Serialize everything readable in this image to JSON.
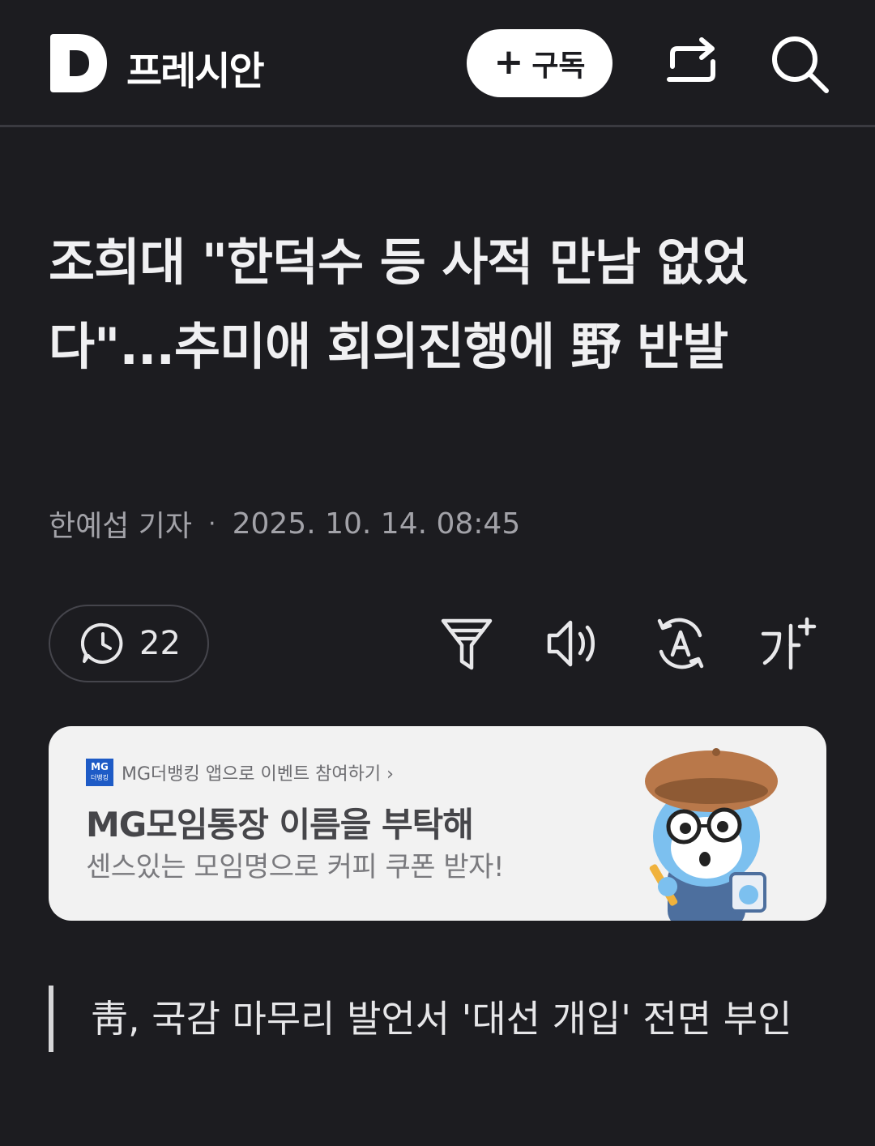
{
  "header": {
    "brand": "프레시안",
    "subscribe_label": "구독",
    "icons": [
      "daum-logo-icon",
      "plus-icon",
      "share-icon",
      "search-icon"
    ]
  },
  "article": {
    "headline": "조희대 \"한덕수 등 사적 만남 없었다\"...추미애 회의진행에 野 반발",
    "author": "한예섭 기자",
    "dot": "·",
    "datetime": "2025. 10. 14. 08:45"
  },
  "toolbar": {
    "comment_count": "22",
    "icons": [
      "comment-icon",
      "filter-icon",
      "speaker-icon",
      "translate-icon",
      "font-size-icon"
    ]
  },
  "ad": {
    "badge_main": "MG",
    "badge_sub": "더뱅킹",
    "sponsor": "MG더뱅킹 앱으로 이벤트 참여하기 ›",
    "title": "MG모임통장 이름을 부탁해",
    "subtitle": "센스있는 모임명으로 커피 쿠폰 받자!"
  },
  "quote": {
    "text": "靑, 국감 마무리 발언서 '대선 개입' 전면 부인"
  },
  "colors": {
    "background": "#1c1c20",
    "text": "#ececee",
    "muted": "#a2a2a8",
    "ad_background": "#f2f2f2",
    "mg_blue": "#1e5bc6"
  }
}
